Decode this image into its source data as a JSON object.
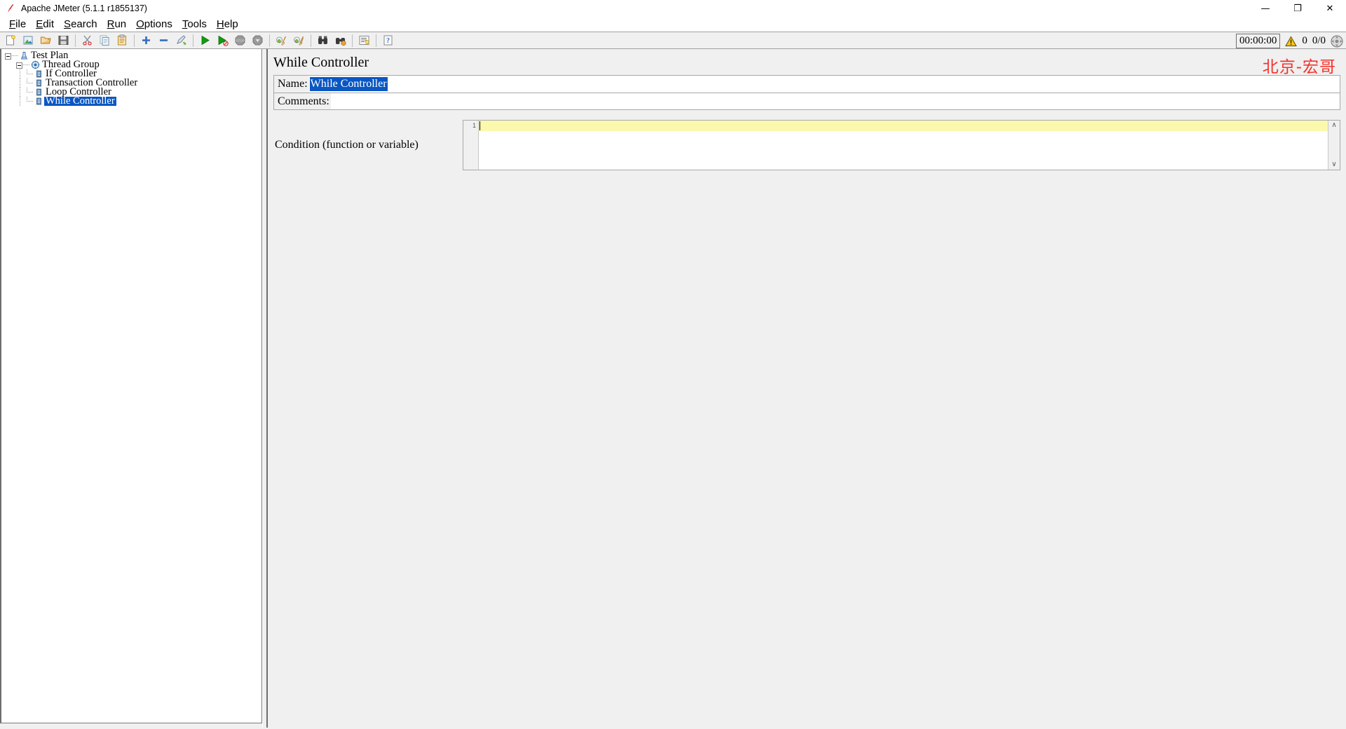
{
  "window": {
    "title": "Apache JMeter (5.1.1 r1855137)",
    "app_icon": "jmeter-feather-icon",
    "minimize_label": "—",
    "restore_label": "❐",
    "close_label": "✕"
  },
  "menubar": {
    "items": [
      {
        "name": "file",
        "pre": "",
        "key": "F",
        "post": "ile"
      },
      {
        "name": "edit",
        "pre": "",
        "key": "E",
        "post": "dit"
      },
      {
        "name": "search",
        "pre": "",
        "key": "S",
        "post": "earch"
      },
      {
        "name": "run",
        "pre": "",
        "key": "R",
        "post": "un"
      },
      {
        "name": "options",
        "pre": "",
        "key": "O",
        "post": "ptions"
      },
      {
        "name": "tools",
        "pre": "",
        "key": "T",
        "post": "ools"
      },
      {
        "name": "help",
        "pre": "",
        "key": "H",
        "post": "elp"
      }
    ]
  },
  "toolbar": {
    "buttons": [
      {
        "name": "new-button",
        "icon": "new-document-icon",
        "color": "#f2f2f2"
      },
      {
        "name": "templates-button",
        "icon": "templates-icon",
        "color": "#4a9e4a"
      },
      {
        "name": "open-button",
        "icon": "open-folder-icon",
        "color": "#e8a33d"
      },
      {
        "name": "save-button",
        "icon": "save-disk-icon",
        "color": "#6d6d6d"
      },
      {
        "name": "cut-button",
        "icon": "scissors-icon",
        "color": "#d03a3a"
      },
      {
        "name": "copy-button",
        "icon": "copy-icon",
        "color": "#9aaec4"
      },
      {
        "name": "paste-button",
        "icon": "clipboard-paste-icon",
        "color": "#c8922e"
      },
      {
        "name": "expand-all-button",
        "icon": "plus-icon",
        "color": "#2f6fbf"
      },
      {
        "name": "collapse-all-button",
        "icon": "minus-icon",
        "color": "#2f6fbf"
      },
      {
        "name": "toggle-button",
        "icon": "toggle-pencil-icon",
        "color": "#7ab648"
      },
      {
        "name": "start-button",
        "icon": "play-icon",
        "color": "#119c11"
      },
      {
        "name": "start-no-pauses-button",
        "icon": "play-no-pauses-icon",
        "color": "#119c11"
      },
      {
        "name": "stop-button",
        "icon": "stop-icon",
        "color": "#9a9a9a"
      },
      {
        "name": "shutdown-button",
        "icon": "shutdown-icon",
        "color": "#9a9a9a"
      },
      {
        "name": "clear-button",
        "icon": "clear-broom-icon",
        "color": "#8fbf4a"
      },
      {
        "name": "clear-all-button",
        "icon": "clear-all-broom-icon",
        "color": "#8fbf4a"
      },
      {
        "name": "search-button",
        "icon": "binoculars-icon",
        "color": "#3a3a3a"
      },
      {
        "name": "search-reset-button",
        "icon": "binoculars-reset-icon",
        "color": "#c8922e"
      },
      {
        "name": "function-helper-button",
        "icon": "function-helper-icon",
        "color": "#6a6a6a"
      },
      {
        "name": "help-button",
        "icon": "help-icon",
        "color": "#2f6fbf"
      }
    ],
    "separators_after": [
      3,
      6,
      9,
      13,
      15,
      17,
      18
    ]
  },
  "status": {
    "timer": "00:00:00",
    "warning_icon": "warning-triangle-icon",
    "warning_count": "0",
    "threads": "0/0",
    "connection_icon": "connection-status-icon"
  },
  "tree": {
    "nodes": [
      {
        "name": "test-plan",
        "label": "Test Plan",
        "depth": 0,
        "icon": "test-plan-icon",
        "selected": false,
        "expander": true,
        "last": false
      },
      {
        "name": "thread-group",
        "label": "Thread Group",
        "depth": 1,
        "icon": "thread-group-icon",
        "selected": false,
        "expander": true,
        "last": false
      },
      {
        "name": "if-controller",
        "label": "If Controller",
        "depth": 2,
        "icon": "controller-icon",
        "selected": false,
        "expander": false,
        "last": false
      },
      {
        "name": "transaction-controller",
        "label": "Transaction Controller",
        "depth": 2,
        "icon": "controller-icon",
        "selected": false,
        "expander": false,
        "last": false
      },
      {
        "name": "loop-controller",
        "label": "Loop Controller",
        "depth": 2,
        "icon": "controller-icon",
        "selected": false,
        "expander": false,
        "last": false
      },
      {
        "name": "while-controller",
        "label": "While Controller",
        "depth": 2,
        "icon": "controller-icon",
        "selected": true,
        "expander": false,
        "last": true
      }
    ]
  },
  "panel": {
    "title": "While Controller",
    "watermark": "北京-宏哥",
    "name_label": "Name:",
    "name_value": "While Controller",
    "name_selected": true,
    "comments_label": "Comments:",
    "comments_value": "",
    "comments_placeholder": "",
    "condition_label": "Condition (function or variable)",
    "condition_value": "",
    "editor_line_number": "1",
    "scroll_up_glyph": "∧",
    "scroll_down_glyph": "∨"
  },
  "colors": {
    "selection_blue": "#0a57c2",
    "watermark_red": "#f4322c",
    "current_line_yellow": "#fbf9ad",
    "panel_gray": "#f0f0f0"
  }
}
